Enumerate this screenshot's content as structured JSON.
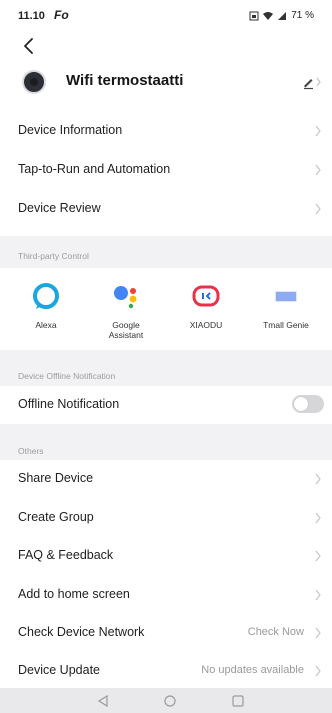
{
  "status_bar": {
    "time": "11.10",
    "app_indicator": "Fo",
    "battery": "71 %",
    "icons": [
      "sim-icon",
      "wifi-icon",
      "signal-icon"
    ]
  },
  "header": {
    "back_icon": "back-chevron-icon",
    "device_name": "Wifi termostaatti",
    "edit_icon": "edit-pencil-icon"
  },
  "menu_top": [
    {
      "label": "Device Information"
    },
    {
      "label": "Tap-to-Run and Automation"
    },
    {
      "label": "Device Review"
    }
  ],
  "third_party": {
    "title": "Third-party Control",
    "items": [
      {
        "label": "Alexa",
        "icon": "alexa-icon"
      },
      {
        "label": "Google\nAssistant",
        "icon": "google-assistant-icon"
      },
      {
        "label": "XIAODU",
        "icon": "xiaodu-icon"
      },
      {
        "label": "Tmall Genie",
        "icon": "tmall-genie-icon"
      }
    ]
  },
  "offline": {
    "title": "Device Offline Notification",
    "label": "Offline Notification",
    "enabled": false
  },
  "others": {
    "title": "Others",
    "items": [
      {
        "label": "Share Device",
        "value": ""
      },
      {
        "label": "Create Group",
        "value": ""
      },
      {
        "label": "FAQ & Feedback",
        "value": ""
      },
      {
        "label": "Add to home screen",
        "value": ""
      },
      {
        "label": "Check Device Network",
        "value": "Check Now"
      },
      {
        "label": "Device Update",
        "value": "No updates available"
      }
    ]
  },
  "nav_bar": {
    "back": "nav-back-icon",
    "home": "nav-home-icon",
    "recents": "nav-recents-icon"
  },
  "colors": {
    "alexa": "#1aa7e0",
    "google_blue": "#4285f4",
    "google_red": "#ea4335",
    "google_yellow": "#fbbc05",
    "google_green": "#34a853",
    "xiaodu": "#e8314b",
    "tmall": "#3d6ee8"
  }
}
